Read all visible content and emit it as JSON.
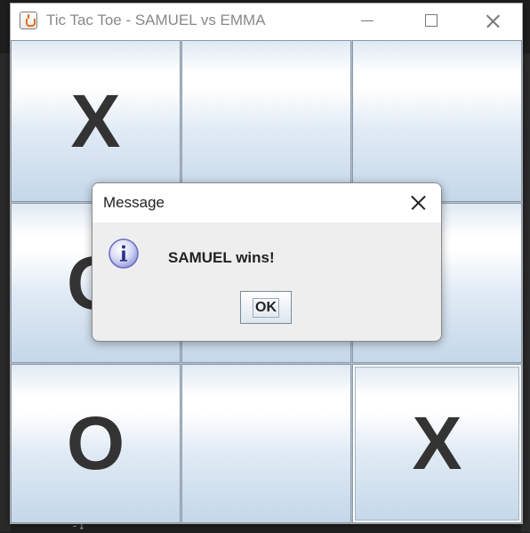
{
  "window": {
    "title": "Tic Tac Toe - SAMUEL vs EMMA",
    "icon": "java-cup-icon"
  },
  "board": {
    "cells": [
      "X",
      "",
      "",
      "O",
      "",
      "",
      "O",
      "",
      "X"
    ]
  },
  "dialog": {
    "title": "Message",
    "message": "SAMUEL wins!",
    "ok_label": "OK",
    "icon": "info-icon"
  },
  "background": {
    "bottom_glyph": "-↓"
  }
}
